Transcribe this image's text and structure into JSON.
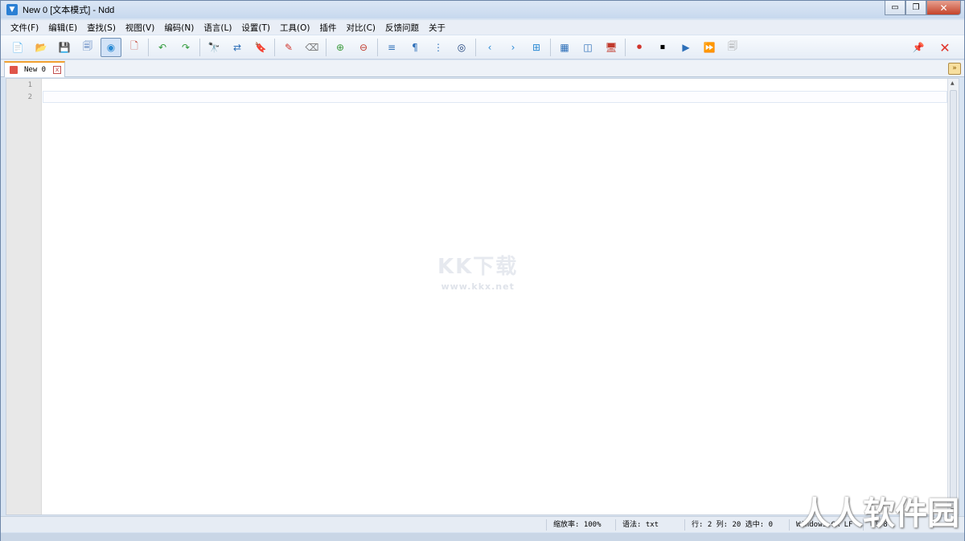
{
  "window": {
    "title": "New 0 [文本模式] - Ndd",
    "minimize_label": "▭",
    "restore_label": "❐",
    "close_label": "✕"
  },
  "menu": [
    "文件(F)",
    "编辑(E)",
    "查找(S)",
    "视图(V)",
    "编码(N)",
    "语言(L)",
    "设置(T)",
    "工具(O)",
    "插件",
    "对比(C)",
    "反馈问题",
    "关于"
  ],
  "toolbar": {
    "icons": [
      {
        "name": "new-file-icon",
        "glyph": "📄",
        "color": "#4a9d4a"
      },
      {
        "name": "open-folder-icon",
        "glyph": "📂",
        "color": "#d8a030"
      },
      {
        "name": "save-icon",
        "glyph": "💾",
        "color": "#3d6cb3"
      },
      {
        "name": "save-all-icon",
        "glyph": "🗐",
        "color": "#3d6cb3"
      },
      {
        "name": "text-mode-icon",
        "glyph": "◉",
        "color": "#2a8ad4",
        "active": true
      },
      {
        "name": "close-file-icon",
        "glyph": "🗋",
        "color": "#c0392b"
      },
      {
        "sep": true
      },
      {
        "name": "undo-icon",
        "glyph": "↶",
        "color": "#2f9a3a"
      },
      {
        "name": "redo-icon",
        "glyph": "↷",
        "color": "#2f9a3a"
      },
      {
        "sep": true
      },
      {
        "name": "find-icon",
        "glyph": "🔭",
        "color": "#333"
      },
      {
        "name": "replace-icon",
        "glyph": "⇄",
        "color": "#2d6fb8"
      },
      {
        "name": "find-in-files-icon",
        "glyph": "🔖",
        "color": "#2d6fb8"
      },
      {
        "sep": true
      },
      {
        "name": "marker-icon",
        "glyph": "✎",
        "color": "#d0342c"
      },
      {
        "name": "eraser-icon",
        "glyph": "⌫",
        "color": "#777"
      },
      {
        "sep": true
      },
      {
        "name": "zoom-in-icon",
        "glyph": "⊕",
        "color": "#3a9a3a"
      },
      {
        "name": "zoom-out-icon",
        "glyph": "⊖",
        "color": "#c0392b"
      },
      {
        "sep": true
      },
      {
        "name": "word-wrap-icon",
        "glyph": "≡",
        "color": "#2d6fb8"
      },
      {
        "name": "show-symbols-icon",
        "glyph": "¶",
        "color": "#2d6fb8"
      },
      {
        "name": "indent-guide-icon",
        "glyph": "⋮",
        "color": "#2d6fb8"
      },
      {
        "name": "target-icon",
        "glyph": "◎",
        "color": "#1b3f7a"
      },
      {
        "sep": true
      },
      {
        "name": "prev-icon",
        "glyph": "‹",
        "color": "#2a8ad4"
      },
      {
        "name": "next-icon",
        "glyph": "›",
        "color": "#2a8ad4"
      },
      {
        "name": "compare-icon",
        "glyph": "⊞",
        "color": "#2a8ad4"
      },
      {
        "sep": true
      },
      {
        "name": "split-view-icon",
        "glyph": "▦",
        "color": "#2d6fb8"
      },
      {
        "name": "dual-pane-icon",
        "glyph": "◫",
        "color": "#2d6fb8"
      },
      {
        "name": "monitor-icon",
        "glyph": "🖥",
        "color": "#c0392b"
      },
      {
        "sep": true
      },
      {
        "name": "record-macro-icon",
        "glyph": "⏺",
        "color": "#d0342c"
      },
      {
        "name": "stop-macro-icon",
        "glyph": "⏹",
        "color": "#000"
      },
      {
        "name": "play-macro-icon",
        "glyph": "▶",
        "color": "#2d6fb8"
      },
      {
        "name": "run-macro-multiple-icon",
        "glyph": "⏩",
        "color": "#2d6fb8"
      },
      {
        "name": "save-macro-icon",
        "glyph": "🗐",
        "color": "#999"
      }
    ],
    "pin_glyph": "📌",
    "close_glyph": "✕"
  },
  "tabs": [
    {
      "label": "New 0",
      "close": "x"
    }
  ],
  "tab_menu_glyph": "»",
  "editor": {
    "line_numbers": [
      "1",
      "2"
    ]
  },
  "watermark": {
    "logo": "KK下载",
    "url": "www.kkx.net",
    "corner": "人人软件园"
  },
  "status": {
    "zoom": "缩放率: 100%",
    "syntax": "语法: txt",
    "position": "行: 2 列: 20 选中: 0",
    "eol": "Windows CR LF",
    "encoding": "UTF8"
  },
  "colors": {
    "accent": "#2a8ad4",
    "tab_highlight": "#f0a030",
    "close_red": "#e0332a"
  }
}
